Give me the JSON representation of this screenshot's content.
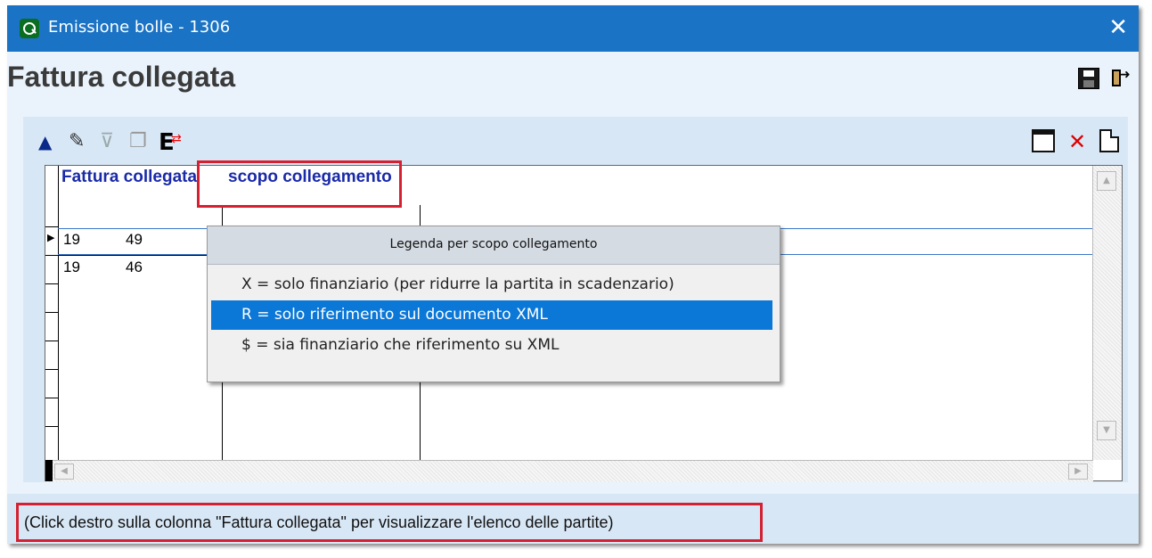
{
  "window": {
    "title": "Emissione bolle - 1306",
    "close_glyph": "✕"
  },
  "form": {
    "heading": "Fattura collegata",
    "save_icon": "save-icon",
    "exit_icon": "exit-door-icon"
  },
  "toolbar": {
    "left_icons": [
      "arrow-up-icon",
      "edit-icon",
      "filter-icon",
      "copy-icon",
      "export-icon"
    ],
    "right_icons": [
      "window-icon",
      "delete-icon",
      "new-document-icon"
    ]
  },
  "grid": {
    "columns": [
      "Fattura collegata",
      "scopo collegamento"
    ],
    "rows": [
      {
        "anno": "19",
        "numero": "49",
        "scopo": ""
      },
      {
        "anno": "19",
        "numero": "46",
        "scopo": ""
      }
    ],
    "current_row_marker": "▶"
  },
  "legend_popup": {
    "title": "Legenda per scopo collegamento",
    "items": [
      {
        "label": "X = solo finanziario (per ridurre la partita in scadenzario)",
        "selected": false
      },
      {
        "label": "R = solo riferimento sul documento XML",
        "selected": true
      },
      {
        "label": "$ = sia finanziario che riferimento su XML",
        "selected": false
      }
    ]
  },
  "status_bar": {
    "text": "(Click destro sulla colonna \"Fattura collegata\" per visualizzare l'elenco delle partite)"
  },
  "colors": {
    "titlebar": "#1a73c4",
    "highlight": "#d42030",
    "selection": "#0b77d6",
    "header_text": "#1a2aa8"
  }
}
